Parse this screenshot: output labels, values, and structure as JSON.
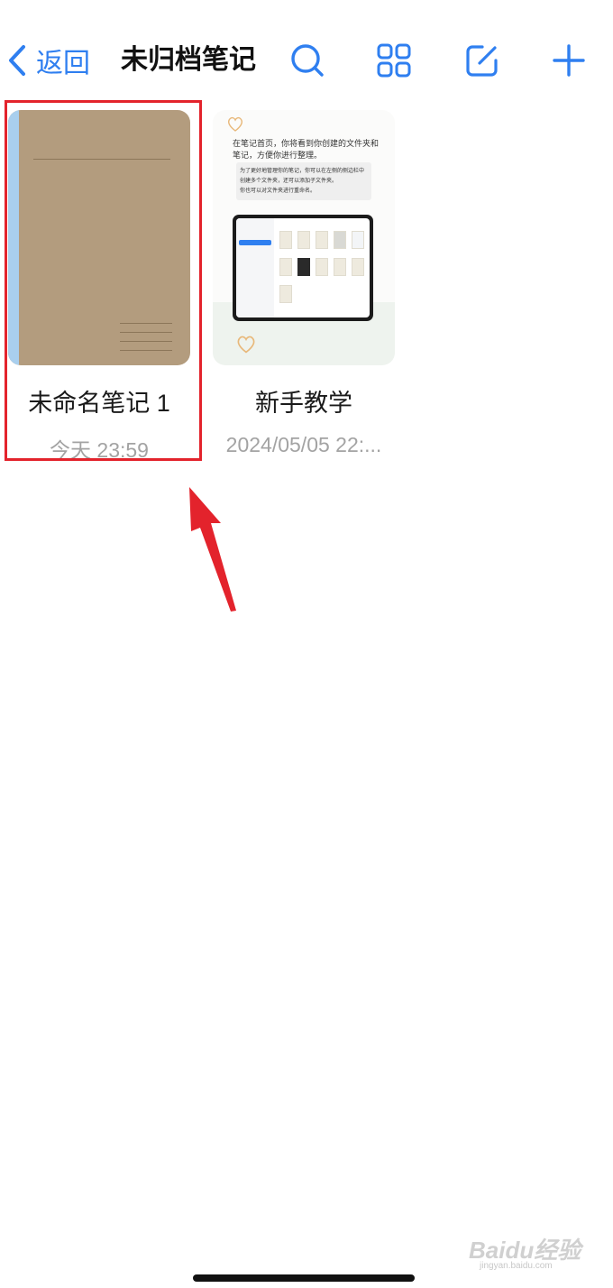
{
  "nav": {
    "back_label": "返回",
    "title": "未归档笔记",
    "icons": [
      "search-icon",
      "grid-view-icon",
      "edit-icon",
      "add-icon"
    ]
  },
  "notebooks": [
    {
      "title": "未命名笔记 1",
      "date": "今天 23:59",
      "cover": "plain-brown",
      "selected": true
    },
    {
      "title": "新手教学",
      "date": "2024/05/05 22:...",
      "cover": "tutorial",
      "cover_text": {
        "line1": "在笔记首页，你将看到你创建的文件夹和",
        "line2": "笔记，方便你进行整理。",
        "box1": "为了更好地管理你的笔记，你可以在左侧的侧边栏中",
        "box2": "创建多个文件夹，还可以添加子文件夹。",
        "box3": "你也可以对文件夹进行重命名。"
      }
    }
  ],
  "watermark": {
    "main": "Baidu经验",
    "sub": "jingyan.baidu.com"
  },
  "colors": {
    "accent": "#2f7ff0",
    "highlight": "#e3232c",
    "cover_brown": "#b39c7e",
    "spine": "#a9cfee"
  }
}
